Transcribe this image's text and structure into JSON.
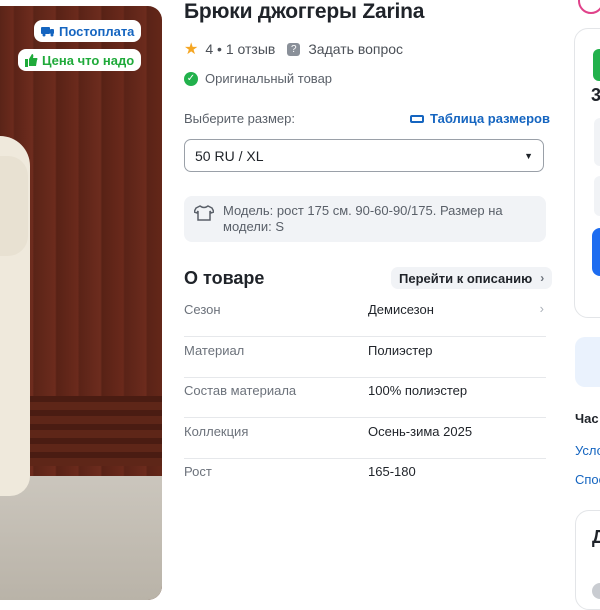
{
  "badges": {
    "postpay": "Постоплата",
    "fair_price": "Цена что надо"
  },
  "product": {
    "title": "Брюки джоггеры Zarina",
    "rating": "4",
    "reviews": "1 отзыв",
    "ask": "Задать вопрос",
    "original": "Оригинальный товар"
  },
  "size": {
    "label": "Выберите размер:",
    "table_link": "Таблица размеров",
    "selected": "50 RU / XL"
  },
  "model_info": "Модель: рост 175 см. 90-60-90/175. Размер на модели: S",
  "about": {
    "title": "О товаре",
    "to_description": "Перейти к описанию",
    "specs": [
      {
        "key": "Сезон",
        "value": "Демисезон"
      },
      {
        "key": "Материал",
        "value": "Полиэстер"
      },
      {
        "key": "Состав материала",
        "value": "100% полиэстер"
      },
      {
        "key": "Коллекция",
        "value": "Осень-зима 2025"
      },
      {
        "key": "Рост",
        "value": "165-180"
      }
    ]
  },
  "right_panel": {
    "partial_num": "3",
    "partial_heading": "Час",
    "partial_link1": "Усло",
    "partial_link2": "Спос",
    "partial_card_title": "Д"
  },
  "colors": {
    "accent": "#1565c0",
    "green": "#22b14c",
    "primary_button": "#1d6cf0",
    "star": "#f5a623"
  }
}
